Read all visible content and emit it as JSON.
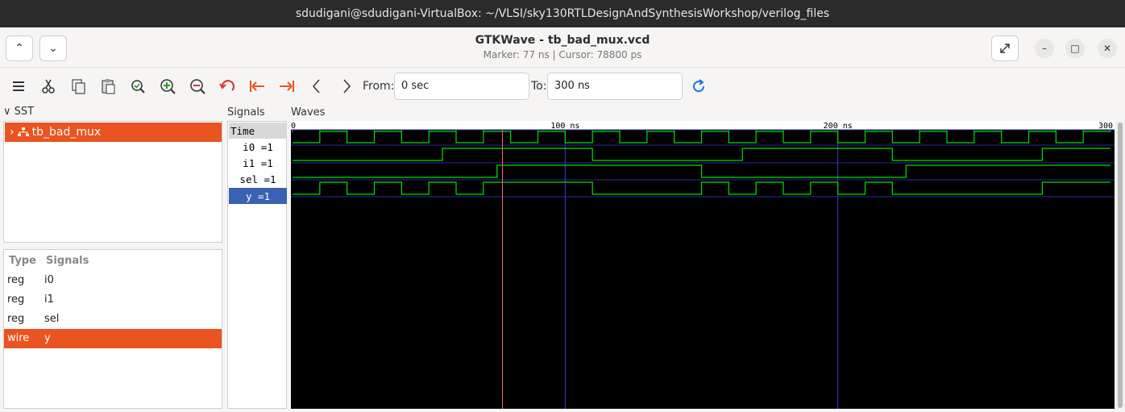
{
  "desktop": {
    "window_title": "sdudigani@sdudigani-VirtualBox: ~/VLSI/sky130RTLDesignAndSynthesisWorkshop/verilog_files"
  },
  "app": {
    "title": "GTKWave - tb_bad_mux.vcd",
    "subtitle": "Marker: 77 ns  |  Cursor: 78800 ps"
  },
  "toolbar": {
    "from_label": "From:",
    "from_value": "0 sec",
    "to_label": "To:",
    "to_value": "300 ns"
  },
  "sst": {
    "header": "SST",
    "tree": [
      {
        "label": "tb_bad_mux"
      }
    ]
  },
  "signal_list": {
    "headers": {
      "type": "Type",
      "signals": "Signals"
    },
    "rows": [
      {
        "type": "reg",
        "name": "i0"
      },
      {
        "type": "reg",
        "name": "i1"
      },
      {
        "type": "reg",
        "name": "sel"
      },
      {
        "type": "wire",
        "name": "y"
      }
    ]
  },
  "signals_panel": {
    "label": "Signals",
    "rows": [
      "Time",
      "i0 =1",
      "i1 =1",
      "sel =1",
      "y =1"
    ]
  },
  "waves": {
    "label": "Waves",
    "time_range_ns": [
      0,
      300
    ],
    "ticks": [
      "0",
      "100 ns",
      "200 ns",
      "300"
    ],
    "marker_ns": 77,
    "signals": {
      "i0": [
        [
          0,
          0
        ],
        [
          10,
          1
        ],
        [
          20,
          0
        ],
        [
          30,
          1
        ],
        [
          40,
          0
        ],
        [
          50,
          1
        ],
        [
          60,
          0
        ],
        [
          70,
          1
        ],
        [
          80,
          0
        ],
        [
          90,
          1
        ],
        [
          100,
          0
        ],
        [
          110,
          1
        ],
        [
          120,
          0
        ],
        [
          130,
          1
        ],
        [
          140,
          0
        ],
        [
          150,
          1
        ],
        [
          160,
          0
        ],
        [
          170,
          1
        ],
        [
          180,
          0
        ],
        [
          190,
          1
        ],
        [
          200,
          0
        ],
        [
          210,
          1
        ],
        [
          220,
          0
        ],
        [
          230,
          1
        ],
        [
          240,
          0
        ],
        [
          250,
          1
        ],
        [
          260,
          0
        ],
        [
          270,
          1
        ],
        [
          280,
          0
        ],
        [
          290,
          1
        ]
      ],
      "i1": [
        [
          0,
          0
        ],
        [
          55,
          1
        ],
        [
          110,
          0
        ],
        [
          165,
          1
        ],
        [
          220,
          0
        ],
        [
          275,
          1
        ]
      ],
      "sel": [
        [
          0,
          0
        ],
        [
          75,
          1
        ],
        [
          150,
          0
        ],
        [
          225,
          1
        ]
      ],
      "y": [
        [
          0,
          0
        ],
        [
          10,
          1
        ],
        [
          20,
          0
        ],
        [
          30,
          1
        ],
        [
          40,
          0
        ],
        [
          50,
          1
        ],
        [
          60,
          0
        ],
        [
          70,
          1
        ],
        [
          110,
          0
        ],
        [
          150,
          1
        ],
        [
          160,
          0
        ],
        [
          170,
          1
        ],
        [
          180,
          0
        ],
        [
          190,
          1
        ],
        [
          200,
          0
        ],
        [
          210,
          1
        ],
        [
          220,
          0
        ],
        [
          275,
          1
        ]
      ]
    }
  },
  "colors": {
    "accent": "#e95420",
    "wave": "#00e000",
    "marker": "#ff6464",
    "selected_signal": "#3a62b2"
  }
}
